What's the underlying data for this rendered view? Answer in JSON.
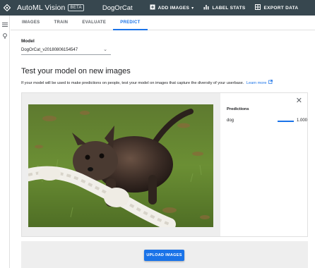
{
  "header": {
    "app_title": "AutoML Vision",
    "beta_badge": "BETA",
    "dataset_name": "DogOrCat",
    "actions": [
      {
        "label": "ADD IMAGES",
        "icon": "add-box-icon"
      },
      {
        "label": "LABEL STATS",
        "icon": "bar-chart-icon"
      },
      {
        "label": "EXPORT DATA",
        "icon": "export-icon"
      }
    ],
    "bg_color": "#37474f"
  },
  "tabs": [
    {
      "label": "IMAGES",
      "active": false
    },
    {
      "label": "TRAIN",
      "active": false
    },
    {
      "label": "EVALUATE",
      "active": false
    },
    {
      "label": "PREDICT",
      "active": true
    }
  ],
  "model": {
    "label": "Model",
    "selected": "DogOrCat_v20180806154547"
  },
  "section": {
    "heading": "Test your model on new images",
    "description": "If your model will be used to make predictions on people, test your model on images that capture the diversity of your userbase.",
    "learn_more": "Learn more"
  },
  "predictions": {
    "title": "Predictions",
    "items": [
      {
        "label": "dog",
        "score": "1.000",
        "fraction": 1.0
      }
    ]
  },
  "upload": {
    "button_label": "UPLOAD IMAGES"
  },
  "accent_color": "#1a73e8"
}
